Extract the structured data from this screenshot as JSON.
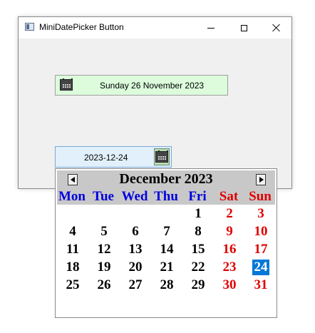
{
  "window": {
    "title": "MiniDatePicker Button"
  },
  "picker1": {
    "value": "Sunday 26 November 2023"
  },
  "picker2": {
    "value": "2023-12-24"
  },
  "calendar": {
    "month_title": "December 2023",
    "weekdays": [
      "Mon",
      "Tue",
      "Wed",
      "Thu",
      "Fri",
      "Sat",
      "Sun"
    ],
    "weeks": [
      [
        "",
        "",
        "",
        "",
        "1",
        "2",
        "3"
      ],
      [
        "4",
        "5",
        "6",
        "7",
        "8",
        "9",
        "10"
      ],
      [
        "11",
        "12",
        "13",
        "14",
        "15",
        "16",
        "17"
      ],
      [
        "18",
        "19",
        "20",
        "21",
        "22",
        "23",
        "24"
      ],
      [
        "25",
        "26",
        "27",
        "28",
        "29",
        "30",
        "31"
      ]
    ],
    "selected_day": "24",
    "colors": {
      "weekday_header": "#0000e0",
      "weekend_header": "#e00000",
      "weekday_number": "#000000",
      "weekend_number": "#e00000",
      "selected_bg": "#0078d7",
      "selected_fg": "#ffffff"
    }
  }
}
